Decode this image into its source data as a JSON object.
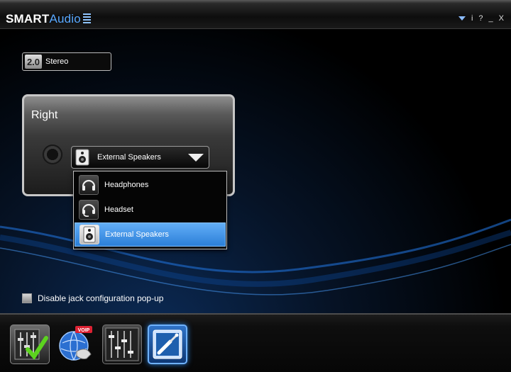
{
  "app": {
    "brand_primary": "SMART",
    "brand_secondary": "Audio"
  },
  "window_controls": {
    "menu_icon": "caret-down-icon",
    "info": "i",
    "help": "?",
    "minimize": "_",
    "close": "X"
  },
  "speaker_config": {
    "badge": "2.0",
    "label": "Stereo"
  },
  "jack_panel": {
    "title": "Right",
    "selected_device": "External Speakers"
  },
  "device_menu": {
    "items": [
      {
        "label": "Headphones",
        "icon": "headphones-icon",
        "selected": false
      },
      {
        "label": "Headset",
        "icon": "headset-icon",
        "selected": false
      },
      {
        "label": "External Speakers",
        "icon": "speaker-icon",
        "selected": true
      }
    ]
  },
  "options": {
    "disable_popup_label": "Disable jack configuration pop-up",
    "disable_popup_checked": false
  },
  "bottom_tabs": [
    {
      "name": "equalizer-tab",
      "icon": "mixer-check-icon"
    },
    {
      "name": "voip-tab",
      "icon": "voip-icon",
      "badge": "VOIP"
    },
    {
      "name": "mixer-tab",
      "icon": "sliders-icon"
    },
    {
      "name": "jack-config-tab",
      "icon": "audio-jack-icon",
      "active": true
    }
  ],
  "colors": {
    "accent": "#2b7fd8",
    "selection": "#4a9cf0",
    "brand_audio": "#58a8ff"
  }
}
